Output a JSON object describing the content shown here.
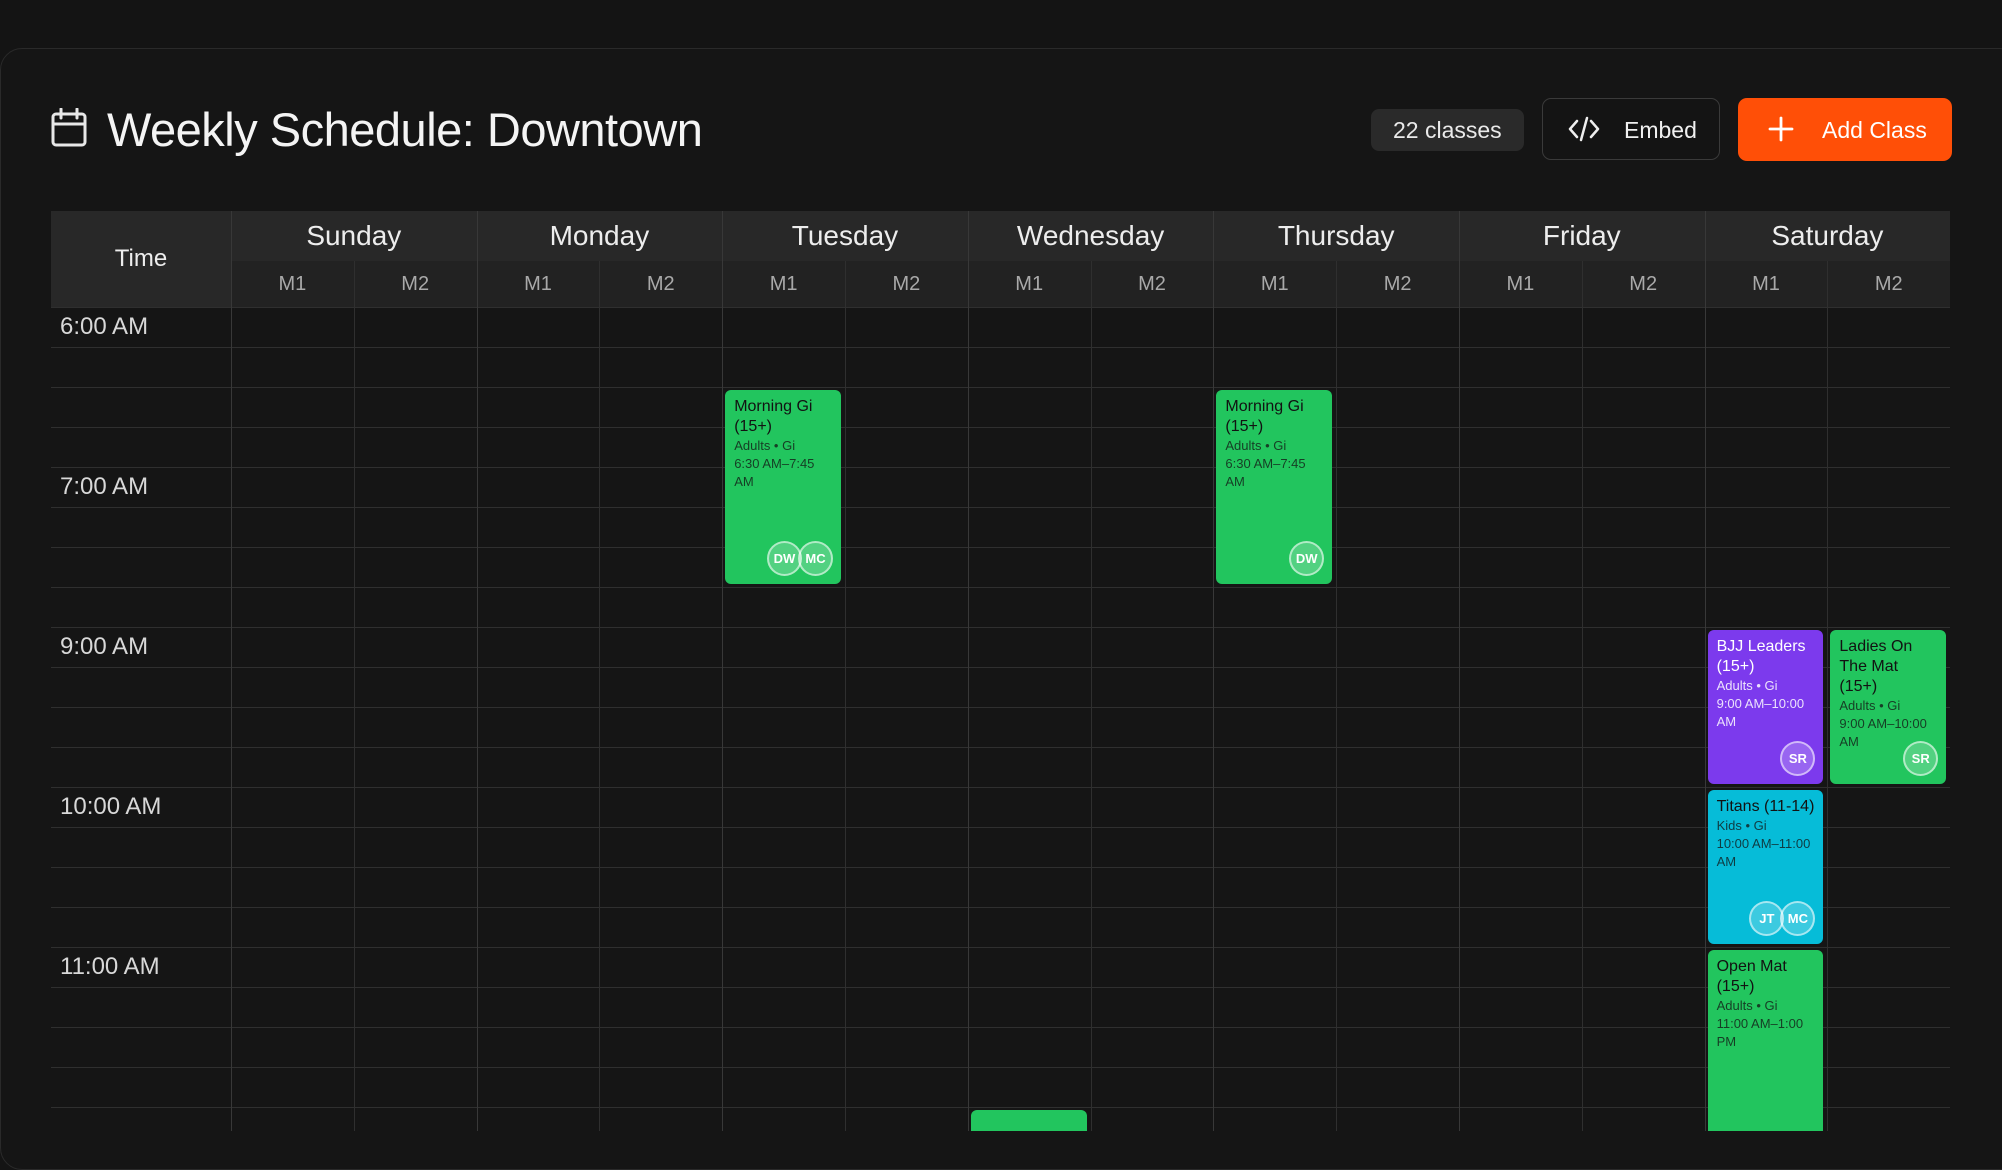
{
  "header": {
    "title": "Weekly Schedule: Downtown",
    "class_count": "22 classes",
    "embed_label": "Embed",
    "add_label": "Add Class"
  },
  "grid": {
    "time_header": "Time",
    "days": [
      {
        "name": "Sunday",
        "mats": [
          "M1",
          "M2"
        ]
      },
      {
        "name": "Monday",
        "mats": [
          "M1",
          "M2"
        ]
      },
      {
        "name": "Tuesday",
        "mats": [
          "M1",
          "M2"
        ]
      },
      {
        "name": "Wednesday",
        "mats": [
          "M1",
          "M2"
        ]
      },
      {
        "name": "Thursday",
        "mats": [
          "M1",
          "M2"
        ]
      },
      {
        "name": "Friday",
        "mats": [
          "M1",
          "M2"
        ]
      },
      {
        "name": "Saturday",
        "mats": [
          "M1",
          "M2"
        ]
      }
    ],
    "time_labels": [
      "6:00 AM",
      "7:00 AM",
      "9:00 AM",
      "10:00 AM",
      "11:00 AM"
    ]
  },
  "events": [
    {
      "title": "Morning Gi (15+)",
      "meta": "Adults • Gi",
      "time": "6:30 AM–7:45 AM",
      "day": "Tuesday",
      "mat": "M1",
      "color": "#22c55e",
      "avatars": [
        "DW",
        "MC"
      ]
    },
    {
      "title": "Morning Gi (15+)",
      "meta": "Adults • Gi",
      "time": "6:30 AM–7:45 AM",
      "day": "Thursday",
      "mat": "M1",
      "color": "#22c55e",
      "avatars": [
        "DW"
      ]
    },
    {
      "title": "BJJ Leaders (15+)",
      "meta": "Adults • Gi",
      "time": "9:00 AM–10:00 AM",
      "day": "Saturday",
      "mat": "M1",
      "color": "#7c3aed",
      "avatars": [
        "SR"
      ]
    },
    {
      "title": "Ladies On The Mat (15+)",
      "meta": "Adults • Gi",
      "time": "9:00 AM–10:00 AM",
      "day": "Saturday",
      "mat": "M2",
      "color": "#22c55e",
      "avatars": [
        "SR"
      ]
    },
    {
      "title": "Titans (11-14)",
      "meta": "Kids • Gi",
      "time": "10:00 AM–11:00 AM",
      "day": "Saturday",
      "mat": "M1",
      "color": "#06bcd8",
      "avatars": [
        "JT",
        "MC"
      ]
    },
    {
      "title": "Open Mat (15+)",
      "meta": "Adults • Gi",
      "time": "11:00 AM–1:00 PM",
      "day": "Saturday",
      "mat": "M1",
      "color": "#22c55e",
      "avatars": []
    }
  ],
  "icons": {
    "calendar": "calendar-icon",
    "embed": "code-icon",
    "add": "plus-icon"
  },
  "colors": {
    "accent": "#ff4f07",
    "background": "#141414"
  }
}
